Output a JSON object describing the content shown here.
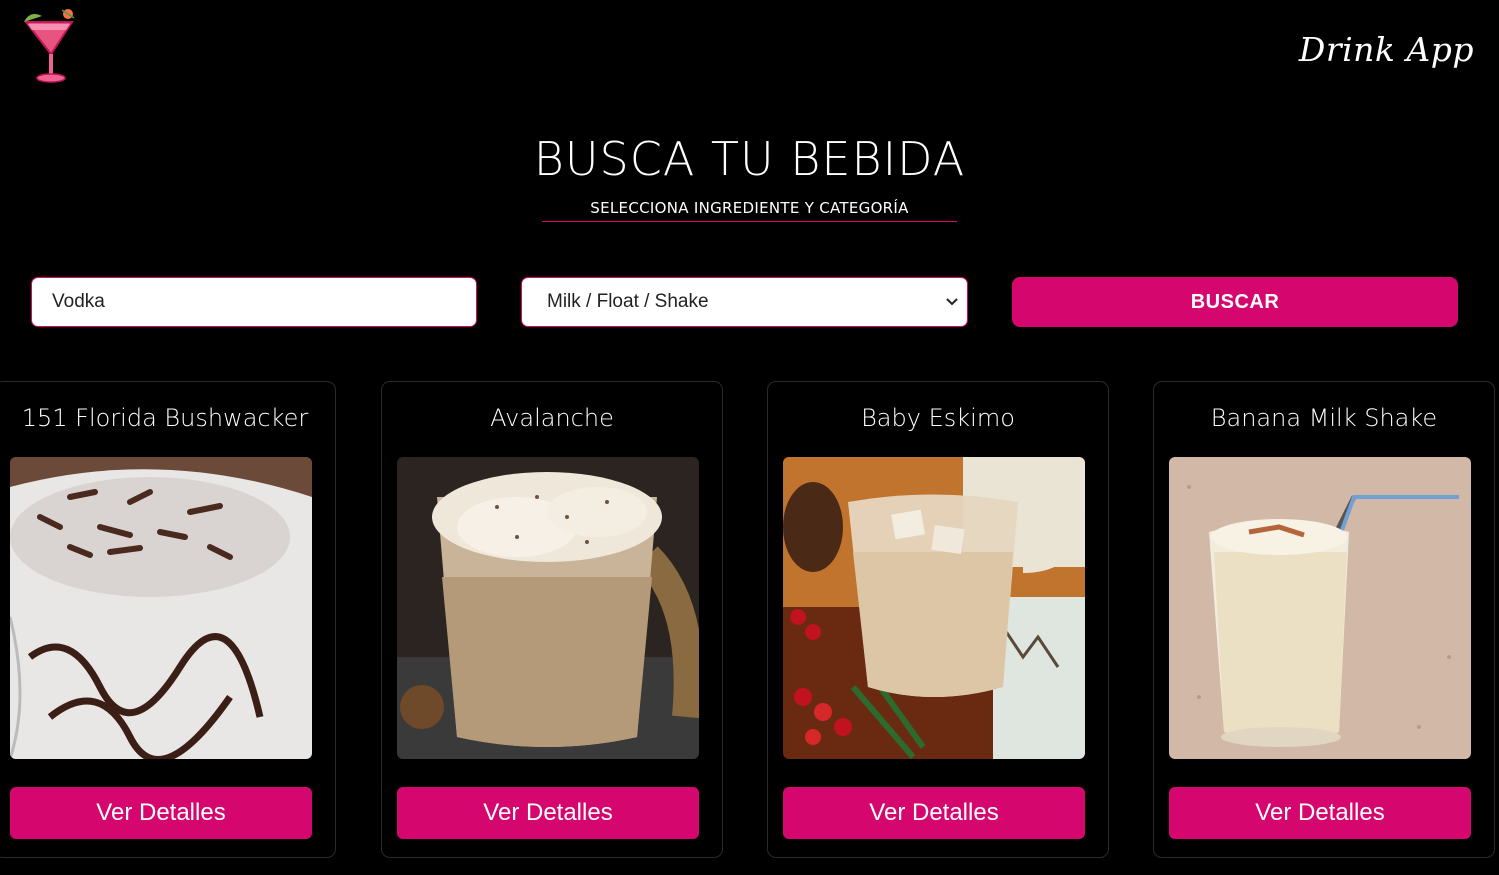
{
  "header": {
    "logo_icon": "cocktail-glass-icon",
    "brand": "Drink App"
  },
  "hero": {
    "title": "BUSCA TU BEBIDA",
    "subtitle": "SELECCIONA INGREDIENTE Y CATEGORÍA"
  },
  "search": {
    "ingredient_value": "Vodka",
    "category_selected": "Milk / Float / Shake",
    "submit_label": "BUSCAR"
  },
  "colors": {
    "accent": "#d5076f",
    "background": "#000000"
  },
  "drinks": [
    {
      "name": "151 Florida Bushwacker",
      "button": "Ver Detalles"
    },
    {
      "name": "Avalanche",
      "button": "Ver Detalles"
    },
    {
      "name": "Baby Eskimo",
      "button": "Ver Detalles"
    },
    {
      "name": "Banana Milk Shake",
      "button": "Ver Detalles"
    }
  ]
}
